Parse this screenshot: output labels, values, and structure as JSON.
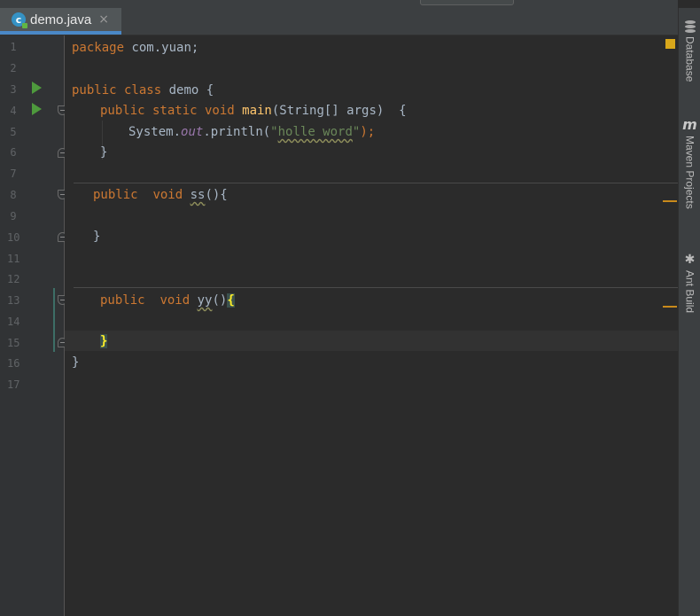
{
  "tab": {
    "filename": "demo.java",
    "close": "×",
    "icon_letter": "c"
  },
  "line_numbers": [
    "1",
    "2",
    "3",
    "4",
    "5",
    "6",
    "7",
    "8",
    "9",
    "10",
    "11",
    "12",
    "13",
    "14",
    "15",
    "16",
    "17"
  ],
  "code": {
    "l1_kw": "package",
    "l1_rest": " com.yuan;",
    "l3_kw": "public class",
    "l3_rest": " demo {",
    "l4_kw": "public static void",
    "l4_fn": " main",
    "l4_rest": "(String[] args)  {",
    "l5_obj": "System.",
    "l5_field": "out",
    "l5_call": ".println(",
    "l5_str_q1": "\"",
    "l5_str": "holle word",
    "l5_str_q2": "\"",
    "l5_end": ");",
    "l6": "}",
    "l8_kw1": "public",
    "l8_kw2": "void",
    "l8_name": "ss",
    "l8_rest": "(){",
    "l10": "}",
    "l13_kw1": "public",
    "l13_kw2": "void",
    "l13_name": "yy",
    "l13_rest": "()",
    "l13_brace": "{",
    "l15_brace": "}",
    "l16": "}"
  },
  "tool_windows": {
    "database": "Database",
    "maven": "Maven Projects",
    "ant": "Ant Build"
  },
  "icons": {
    "database": "database-icon",
    "maven": "maven-icon",
    "ant": "ant-icon"
  },
  "colors": {
    "keyword": "#cc7832",
    "method": "#ffc66d",
    "string": "#6a8759",
    "field": "#9876aa",
    "text": "#a9b7c6",
    "warning_marker": "#d8a71b"
  }
}
